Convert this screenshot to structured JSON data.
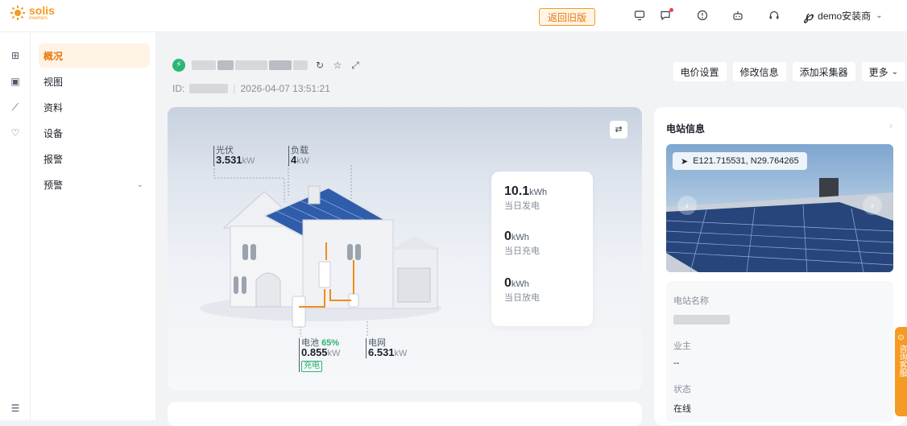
{
  "brand": {
    "name": "solis",
    "sub": "inverters"
  },
  "topbar": {
    "old_version": "返回旧版",
    "user": "demo安装商"
  },
  "menu": [
    {
      "label": "概况"
    },
    {
      "label": "视图"
    },
    {
      "label": "资料"
    },
    {
      "label": "设备"
    },
    {
      "label": "报警"
    },
    {
      "label": "预警"
    }
  ],
  "station": {
    "id_label": "ID:",
    "timestamp": "2026-04-07 13:51:21"
  },
  "actions": {
    "price": "电价设置",
    "edit": "修改信息",
    "add": "添加采集器",
    "more": "更多"
  },
  "flow": {
    "pv": {
      "label": "光伏",
      "value": "3.531",
      "unit": "kW"
    },
    "load": {
      "label": "负载",
      "value": "4",
      "unit": "kW"
    },
    "battery": {
      "label": "电池",
      "pct": "65%",
      "value": "0.855",
      "unit": "kW",
      "state": "充电"
    },
    "grid": {
      "label": "电网",
      "value": "6.531",
      "unit": "kW"
    }
  },
  "stats": [
    {
      "value": "10.1",
      "unit": "kWh",
      "desc": "当日发电"
    },
    {
      "value": "0",
      "unit": "kWh",
      "desc": "当日充电"
    },
    {
      "value": "0",
      "unit": "kWh",
      "desc": "当日放电"
    }
  ],
  "info": {
    "title": "电站信息",
    "coords": "E121.715531, N29.764265",
    "name_label": "电站名称",
    "owner_label": "业主",
    "owner_value": "--",
    "status_label": "状态",
    "status_value": "在线"
  },
  "float_btn": "咨询客服",
  "colors": {
    "brand": "#f59a23",
    "green": "#2bb673",
    "arrow": "#f08c1a"
  }
}
